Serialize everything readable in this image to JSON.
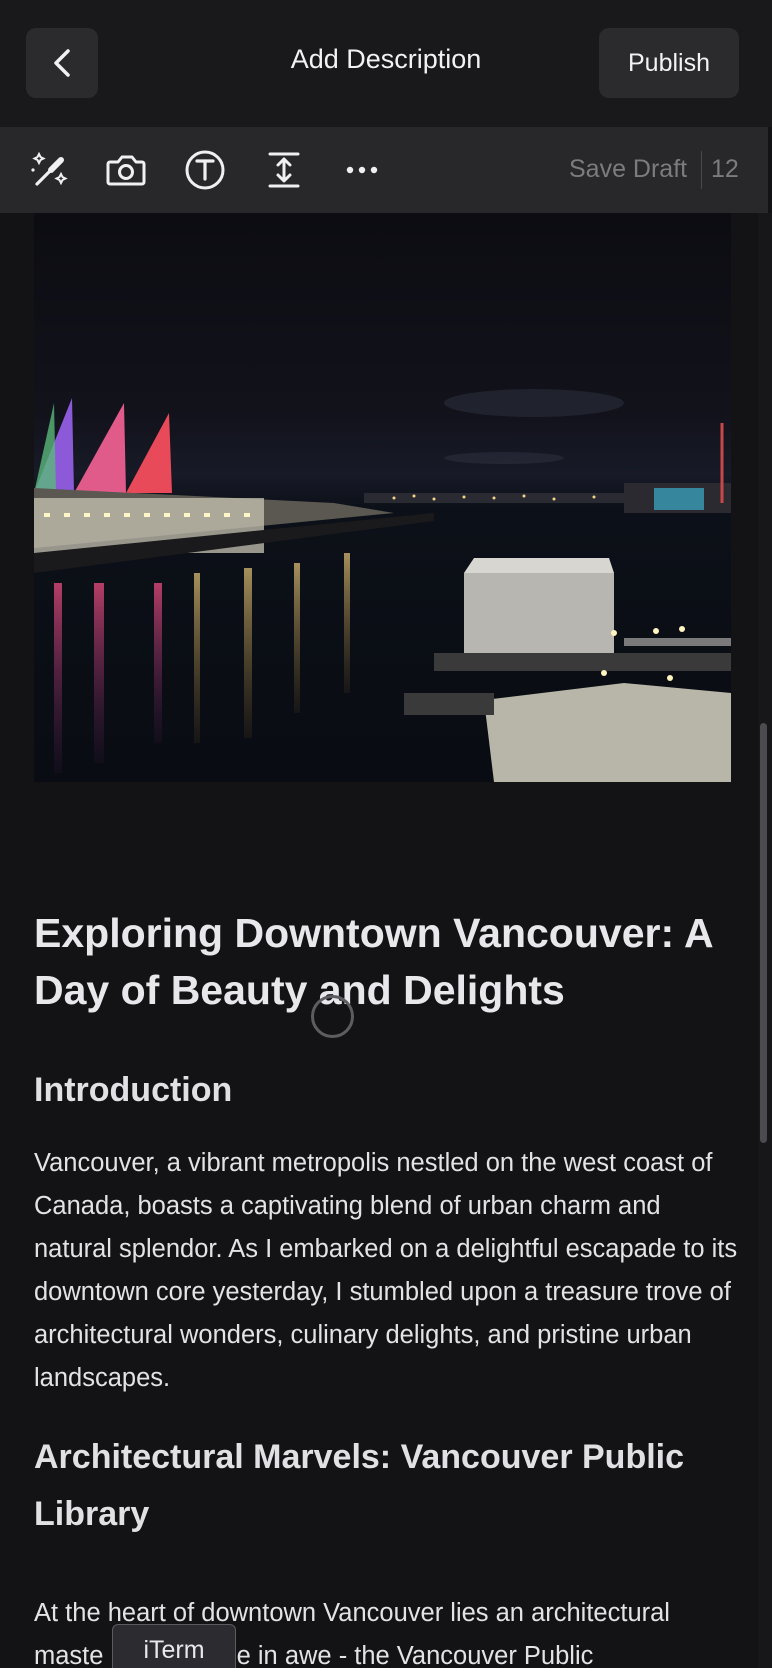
{
  "header": {
    "title": "Add Description",
    "publish_label": "Publish"
  },
  "toolbar": {
    "tools": [
      "magic-wand-icon",
      "camera-icon",
      "text-icon",
      "line-height-icon",
      "more-icon"
    ],
    "save_draft_label": "Save Draft",
    "count": "12"
  },
  "article": {
    "title": "Exploring Downtown Vancouver: A Day of Beauty and Delights",
    "sections": [
      {
        "heading": "Introduction",
        "body": "Vancouver, a vibrant metropolis nestled on the west coast of Canada, boasts a captivating blend of urban charm and natural splendor. As I embarked on a delightful escapade to its downtown core yesterday, I stumbled upon a treasure trove of architectural wonders, culinary delights, and pristine urban landscapes."
      },
      {
        "heading": "Architectural Marvels: Vancouver Public Library",
        "body": "At the heart of downtown Vancouver lies an architectural maste          left me in awe - the Vancouver Public"
      }
    ]
  },
  "tooltip": {
    "text": "iTerm"
  },
  "colors": {
    "background": "#131315",
    "header": "#19191b",
    "toolbar": "#28282a",
    "button": "#2b2b2e",
    "muted_text": "#7b7b80"
  }
}
